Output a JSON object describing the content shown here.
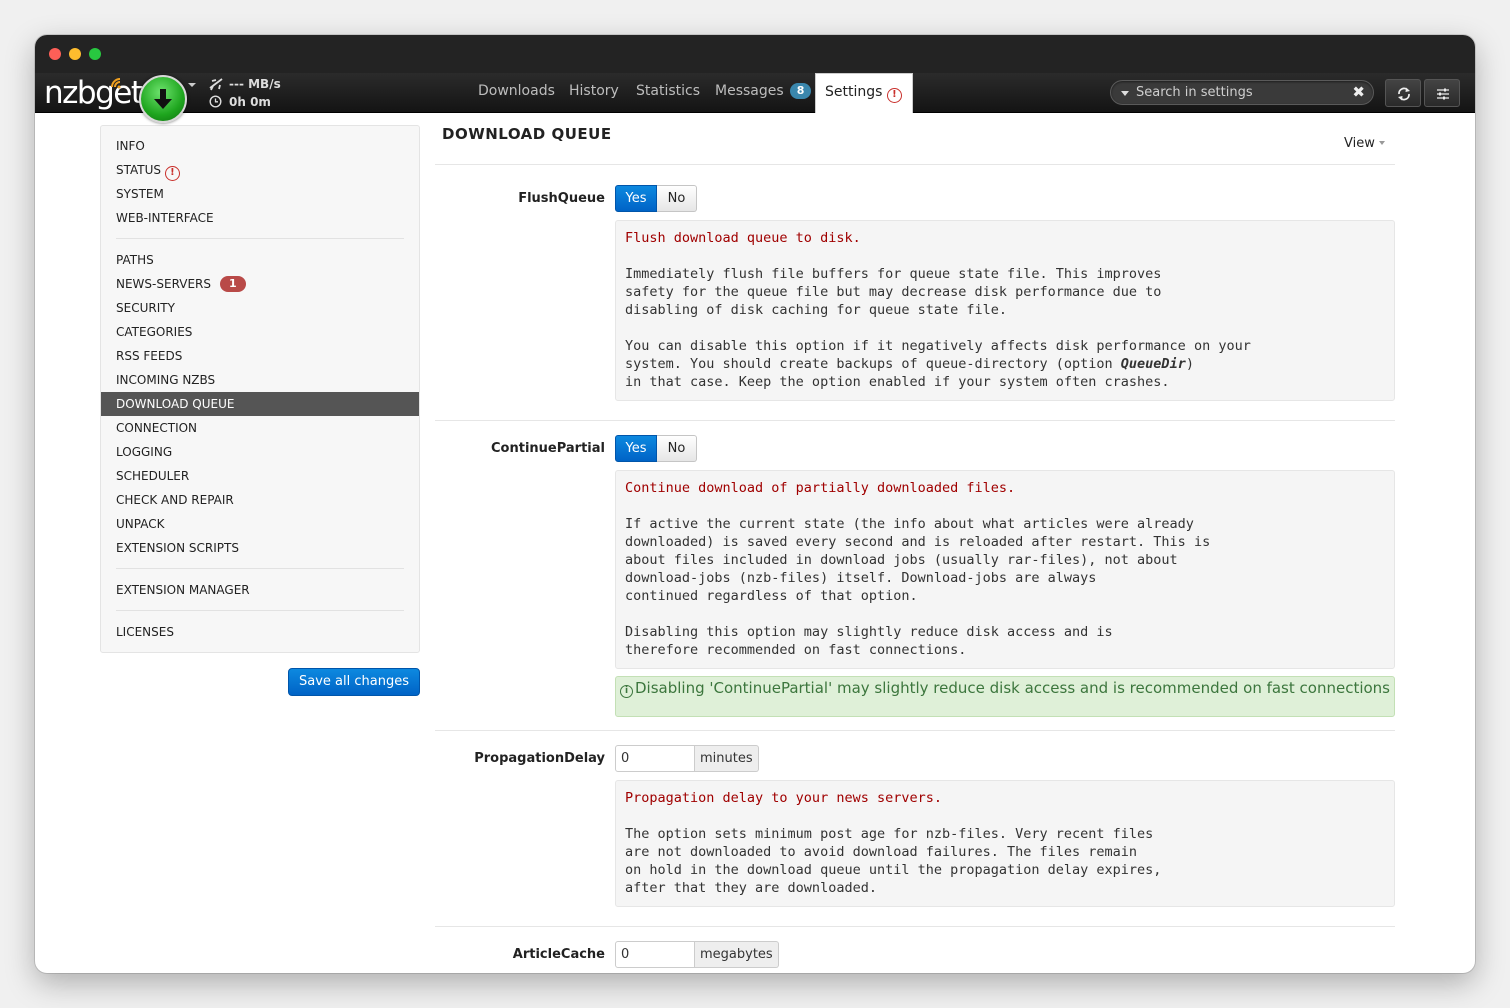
{
  "navbar": {
    "logo": "nzbget",
    "speed": "--- MB/s",
    "time": "0h 0m",
    "tabs": [
      {
        "label": "Downloads"
      },
      {
        "label": "History"
      },
      {
        "label": "Statistics"
      },
      {
        "label": "Messages",
        "badge": "8"
      },
      {
        "label": "Settings"
      }
    ],
    "settings_warning": "!",
    "search_placeholder": "Search in settings",
    "search_clear": "✖"
  },
  "sidebar": {
    "items": [
      {
        "label": "INFO"
      },
      {
        "label": "STATUS",
        "warning": "!"
      },
      {
        "label": "SYSTEM"
      },
      {
        "label": "WEB-INTERFACE"
      },
      {
        "label": "PATHS"
      },
      {
        "label": "NEWS-SERVERS",
        "badge": "1"
      },
      {
        "label": "SECURITY"
      },
      {
        "label": "CATEGORIES"
      },
      {
        "label": "RSS FEEDS"
      },
      {
        "label": "INCOMING NZBS"
      },
      {
        "label": "DOWNLOAD QUEUE"
      },
      {
        "label": "CONNECTION"
      },
      {
        "label": "LOGGING"
      },
      {
        "label": "SCHEDULER"
      },
      {
        "label": "CHECK AND REPAIR"
      },
      {
        "label": "UNPACK"
      },
      {
        "label": "EXTENSION SCRIPTS"
      },
      {
        "label": "EXTENSION MANAGER"
      },
      {
        "label": "LICENSES"
      }
    ],
    "save_label": "Save all changes"
  },
  "main": {
    "title": "DOWNLOAD QUEUE",
    "view_label": "View",
    "options": [
      {
        "name": "FlushQueue",
        "yes": "Yes",
        "no": "No",
        "desc_head": "Flush download queue to disk.",
        "desc_body1": "Immediately flush file buffers for queue state file. This improves\nsafety for the queue file but may decrease disk performance due to\ndisabling of disk caching for queue state file.\n\nYou can disable this option if it negatively affects disk performance on your\nsystem. You should create backups of queue-directory (option ",
        "desc_em": "QueueDir",
        "desc_body2": ")\nin that case. Keep the option enabled if your system often crashes."
      },
      {
        "name": "ContinuePartial",
        "yes": "Yes",
        "no": "No",
        "desc_head": "Continue download of partially downloaded files.",
        "desc_body1": "If active the current state (the info about what articles were already\ndownloaded) is saved every second and is reloaded after restart. This is\nabout files included in download jobs (usually rar-files), not about\ndownload-jobs (nzb-files) itself. Download-jobs are always\ncontinued regardless of that option.\n\nDisabling this option may slightly reduce disk access and is\ntherefore recommended on fast connections.",
        "alert": "Disabling 'ContinuePartial' may slightly reduce disk access and is recommended on fast connections"
      },
      {
        "name": "PropagationDelay",
        "value": "0",
        "unit": "minutes",
        "desc_head": "Propagation delay to your news servers.",
        "desc_body1": "The option sets minimum post age for nzb-files. Very recent files\nare not downloaded to avoid download failures. The files remain\non hold in the download queue until the propagation delay expires,\nafter that they are downloaded."
      },
      {
        "name": "ArticleCache",
        "value": "0",
        "unit": "megabytes"
      }
    ]
  },
  "colors": {
    "accent": "#0073d9",
    "danger": "#c9302c",
    "badge_blue": "#3a87ad",
    "success_bg": "#dff0d8"
  }
}
